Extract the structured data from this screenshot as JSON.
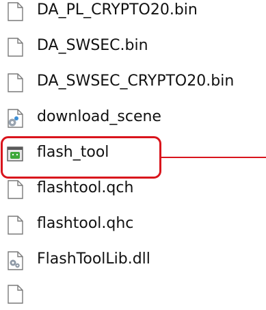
{
  "files": [
    {
      "name": "DA_PL_CRYPTO20.bin",
      "icon": "blank-file-icon"
    },
    {
      "name": "DA_SWSEC.bin",
      "icon": "blank-file-icon"
    },
    {
      "name": "DA_SWSEC_CRYPTO20.bin",
      "icon": "blank-file-icon"
    },
    {
      "name": "download_scene",
      "icon": "settings-file-icon"
    },
    {
      "name": "flash_tool",
      "icon": "application-icon"
    },
    {
      "name": "flashtool.qch",
      "icon": "blank-file-icon"
    },
    {
      "name": "flashtool.qhc",
      "icon": "blank-file-icon"
    },
    {
      "name": "FlashToolLib.dll",
      "icon": "dll-file-icon"
    },
    {
      "name": "",
      "icon": "blank-file-icon"
    }
  ],
  "colors": {
    "highlight": "#d9141c",
    "text": "#111111"
  }
}
